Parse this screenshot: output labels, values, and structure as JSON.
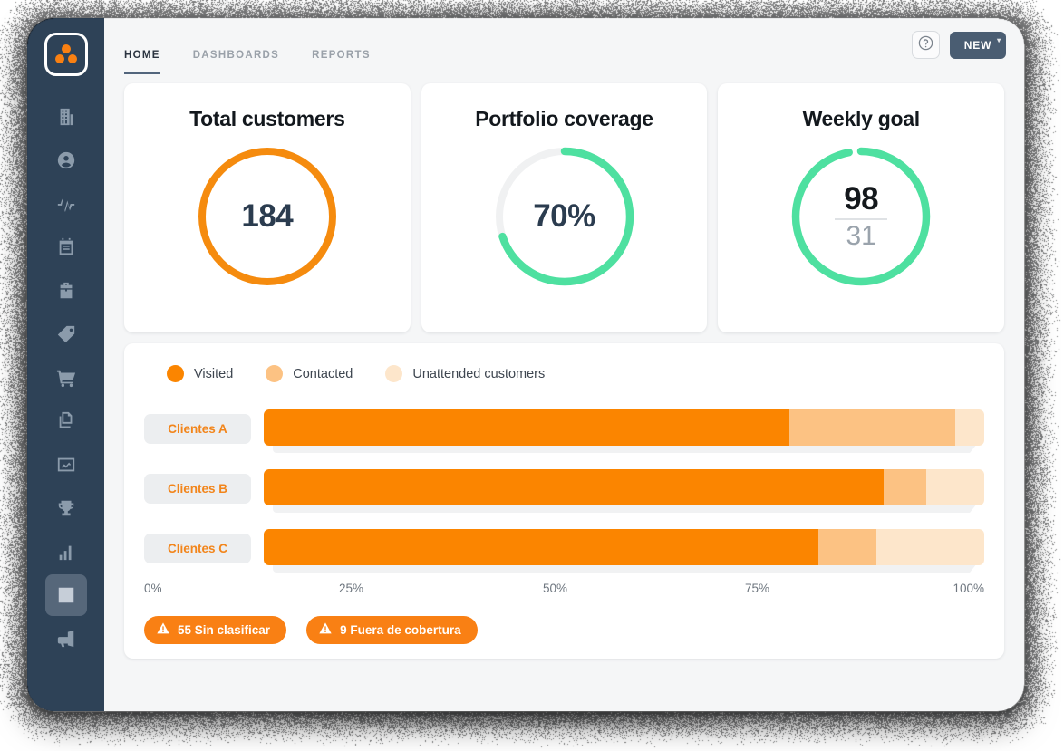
{
  "colors": {
    "sidebar_bg": "#2e4257",
    "accent_orange": "#fb8500",
    "orange_mid": "#fcc283",
    "orange_light": "#fde6cb",
    "green": "#4ee0a0",
    "track_grey": "#eceef0",
    "dark_slate": "#2b3c4f",
    "button_dark": "#4a5d72"
  },
  "sidebar": {
    "logo": {
      "name": "app-logo",
      "dots": 3
    },
    "items": [
      {
        "icon": "building-icon",
        "label": "Companies",
        "active": false
      },
      {
        "icon": "user-circle-icon",
        "label": "Contacts",
        "active": false
      },
      {
        "icon": "activity-icon",
        "label": "Activity",
        "active": false
      },
      {
        "icon": "clipboard-icon",
        "label": "Agenda",
        "active": false
      },
      {
        "icon": "briefcase-icon",
        "label": "Deals",
        "active": false
      },
      {
        "icon": "tag-icon",
        "label": "Products",
        "active": false
      },
      {
        "icon": "cart-icon",
        "label": "Orders",
        "active": false
      },
      {
        "icon": "documents-icon",
        "label": "Documents",
        "active": false
      },
      {
        "icon": "chart-frame-icon",
        "label": "Analytics",
        "active": false
      },
      {
        "icon": "trophy-icon",
        "label": "Goals",
        "active": false
      },
      {
        "icon": "bar-chart-icon",
        "label": "Statistics",
        "active": false
      },
      {
        "icon": "chart-box-icon",
        "label": "Dashboards",
        "active": true
      },
      {
        "icon": "megaphone-icon",
        "label": "Campaigns",
        "active": false
      }
    ]
  },
  "topbar": {
    "tabs": [
      {
        "label": "HOME",
        "active": true
      },
      {
        "label": "DASHBOARDS",
        "active": false
      },
      {
        "label": "REPORTS",
        "active": false
      }
    ],
    "help_icon": "question-circle-icon",
    "new_button": {
      "label": "NEW",
      "caret": "▾"
    }
  },
  "kpi_cards": [
    {
      "title": "Total customers",
      "value": "184",
      "ring_percent": 100,
      "ring_color": "#f58b0e",
      "track_color": "#ffffff",
      "value_color": "#2b3c4f",
      "type": "number"
    },
    {
      "title": "Portfolio coverage",
      "value": "70%",
      "ring_percent": 70,
      "ring_color": "#4ee0a0",
      "track_color": "#f0f1f2",
      "value_color": "#2b3c4f",
      "type": "number"
    },
    {
      "title": "Weekly goal",
      "value": "98",
      "denominator": "31",
      "ring_percent": 97,
      "ring_color": "#4ee0a0",
      "track_color": "#ffffff",
      "value_color": "#14181c",
      "type": "fraction"
    }
  ],
  "chart_data": {
    "type": "bar",
    "orientation": "horizontal",
    "stacked": true,
    "title": "",
    "xlabel": "",
    "ylabel": "",
    "xlim": [
      0,
      100
    ],
    "grid": false,
    "legend_position": "top-left",
    "categories": [
      "Clientes A",
      "Clientes B",
      "Clientes C"
    ],
    "tick_labels": [
      "0%",
      "25%",
      "50%",
      "75%",
      "100%"
    ],
    "tick_values": [
      0,
      25,
      50,
      75,
      100
    ],
    "series": [
      {
        "name": "Visited",
        "color": "#fb8500",
        "values": [
          73,
          86,
          77
        ]
      },
      {
        "name": "Contacted",
        "color": "#fcc283",
        "values": [
          23,
          6,
          8
        ]
      },
      {
        "name": "Unattended customers",
        "color": "#fde6cb",
        "values": [
          4,
          8,
          15
        ]
      }
    ]
  },
  "alerts": [
    {
      "icon": "warning-triangle-icon",
      "label": "55 Sin clasificar"
    },
    {
      "icon": "warning-triangle-icon",
      "label": "9 Fuera de cobertura"
    }
  ]
}
